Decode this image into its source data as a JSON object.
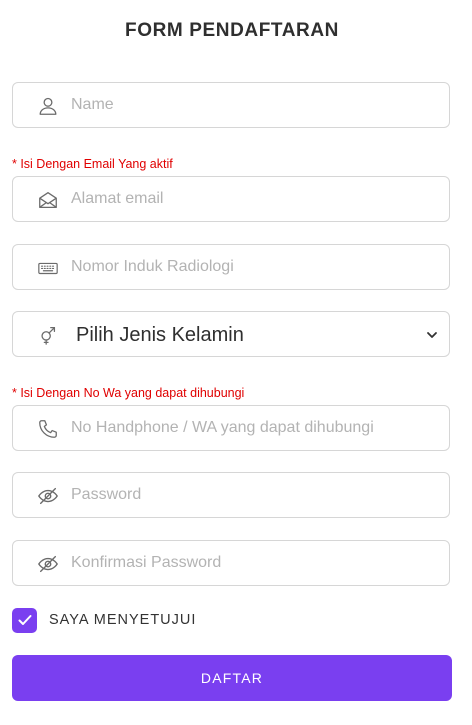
{
  "form": {
    "title": "FORM PENDAFTARAN",
    "fields": {
      "name": {
        "placeholder": "Name",
        "value": "",
        "icon": "user-icon"
      },
      "email_hint": "* Isi Dengan Email Yang aktif",
      "email": {
        "placeholder": "Alamat email",
        "value": "",
        "icon": "envelope-icon"
      },
      "radiology_id": {
        "placeholder": "Nomor Induk Radiologi",
        "value": "",
        "icon": "keyboard-icon"
      },
      "gender": {
        "selected": "Pilih Jenis Kelamin",
        "icon": "gender-icon"
      },
      "phone_hint": "* Isi Dengan No Wa yang dapat dihubungi",
      "phone": {
        "placeholder": "No Handphone / WA yang dapat dihubungi",
        "value": "",
        "icon": "phone-icon"
      },
      "password": {
        "placeholder": "Password",
        "value": "",
        "icon": "eye-slash-icon"
      },
      "confirm_password": {
        "placeholder": "Konfirmasi Password",
        "value": "",
        "icon": "eye-slash-icon"
      }
    },
    "agree": {
      "label": "SAYA MENYETUJUI",
      "checked": true
    },
    "submit_label": "DAFTAR"
  },
  "colors": {
    "accent": "#7a3ff0",
    "hint": "#e00000",
    "border": "#d6d6d6",
    "placeholder": "#b3b3b3"
  }
}
